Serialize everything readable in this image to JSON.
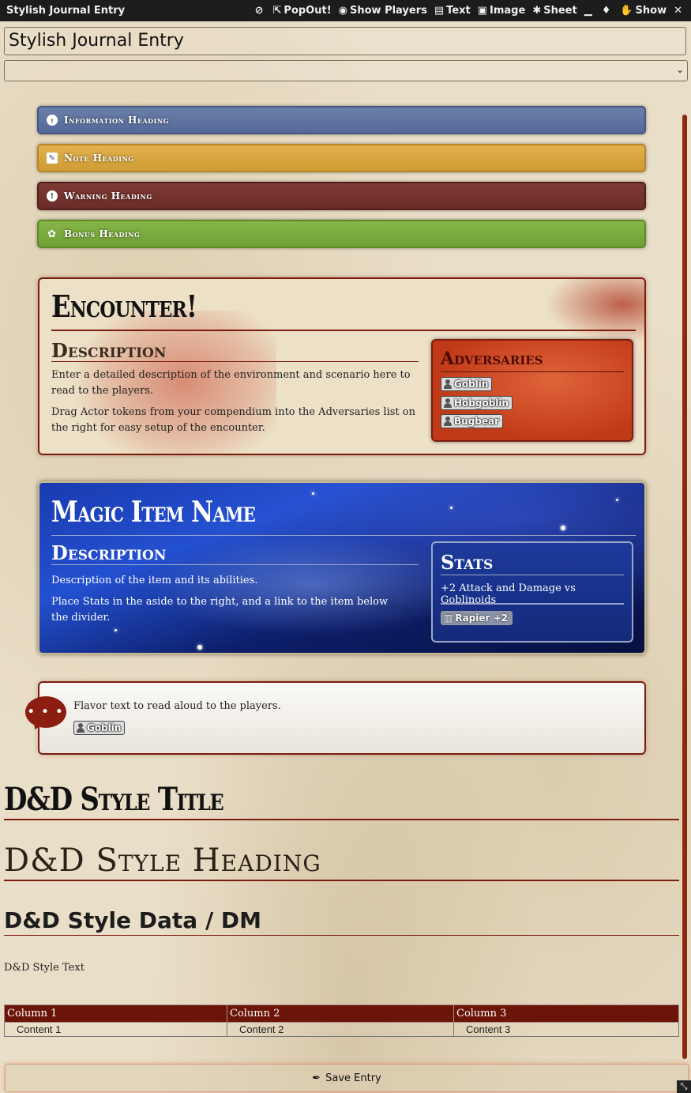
{
  "window": {
    "title": "Stylish Journal Entry",
    "buttons": [
      {
        "label": "",
        "icon": "unlink-icon",
        "glyph": "⊘"
      },
      {
        "label": "PopOut!",
        "icon": "external-link-icon",
        "glyph": "⇱"
      },
      {
        "label": "Show Players",
        "icon": "eye-icon",
        "glyph": "◉"
      },
      {
        "label": "Text",
        "icon": "file-text-icon",
        "glyph": "▤"
      },
      {
        "label": "Image",
        "icon": "image-icon",
        "glyph": "▣"
      },
      {
        "label": "Sheet",
        "icon": "cog-icon",
        "glyph": "✱"
      },
      {
        "label": "",
        "icon": "minimize-icon",
        "glyph": "▁"
      },
      {
        "label": "",
        "icon": "map-pin-icon",
        "glyph": "♦"
      },
      {
        "label": "Show",
        "icon": "hand-icon",
        "glyph": "✋"
      },
      {
        "label": "",
        "icon": "close-icon",
        "glyph": "✕"
      }
    ]
  },
  "entry": {
    "title": "Stylish Journal Entry",
    "select_value": ""
  },
  "callouts": {
    "info": "Information Heading",
    "note": "Note Heading",
    "warning": "Warning Heading",
    "bonus": "Bonus Heading"
  },
  "encounter": {
    "title": "Encounter!",
    "desc_heading": "Description",
    "p1": "Enter a detailed description of the environment and scenario here to read to the players.",
    "p2": "Drag Actor tokens from your compendium into the Adversaries list on the right for easy setup of the encounter.",
    "adv_title": "Adversaries",
    "adversaries": [
      "Goblin",
      "Hobgoblin",
      "Bugbear"
    ]
  },
  "magic_item": {
    "title": "Magic Item Name",
    "desc_heading": "Description",
    "p1": "Description of the item and its abilities.",
    "p2": "Place Stats in the aside to the right, and a link to the item below the divider.",
    "stats_title": "Stats",
    "stats_text": "+2 Attack and Damage vs Goblinoids",
    "item_link": "Rapier +2"
  },
  "flavor": {
    "text": "Flavor text to read aloud to the players.",
    "token": "Goblin"
  },
  "styles": {
    "title": "D&D Style Title",
    "heading": "D&D Style Heading",
    "data": "D&D Style Data / DM",
    "text": "D&D Style Text"
  },
  "table": {
    "headers": [
      "Column 1",
      "Column 2",
      "Column 3"
    ],
    "rows": [
      [
        "Content 1",
        "Content 2",
        "Content 3"
      ]
    ]
  },
  "save": {
    "label": "Save Entry"
  }
}
